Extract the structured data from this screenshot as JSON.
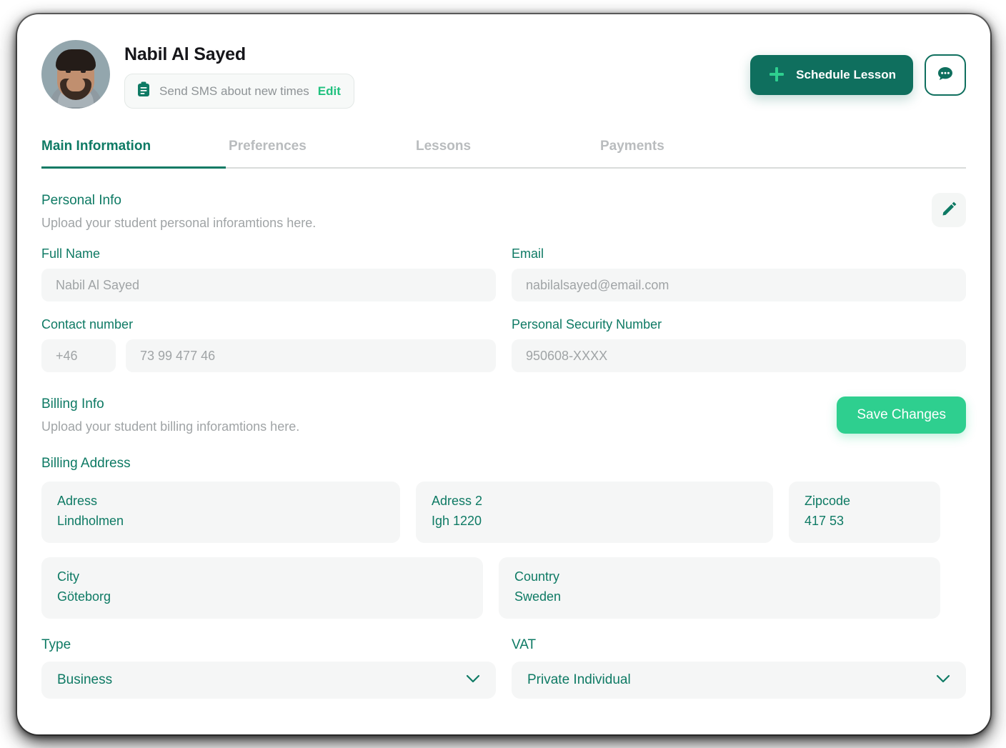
{
  "colors": {
    "teal": "#0e7a64",
    "dark_teal": "#0f6f5e",
    "green": "#2ecf8f",
    "gray_text": "#a0a4a6",
    "field_bg": "#f5f6f6"
  },
  "header": {
    "avatar_alt": "student-avatar",
    "name": "Nabil Al Sayed",
    "sms_badge": {
      "icon": "clipboard-icon",
      "text": "Send SMS about new times",
      "edit_label": "Edit"
    },
    "schedule_button": {
      "icon": "plus-icon",
      "label": "Schedule Lesson"
    },
    "chat_button": {
      "icon": "chat-bubble-dots-icon"
    }
  },
  "tabs": [
    {
      "label": "Main Information",
      "active": true
    },
    {
      "label": "Preferences",
      "active": false
    },
    {
      "label": "Lessons",
      "active": false
    },
    {
      "label": "Payments",
      "active": false
    }
  ],
  "personal_info": {
    "title": "Personal Info",
    "subtitle": "Upload your student personal inforamtions here.",
    "edit_icon": "pencil-icon",
    "fields": {
      "full_name": {
        "label": "Full Name",
        "placeholder": "Nabil Al Sayed",
        "value": ""
      },
      "email": {
        "label": "Email",
        "placeholder": "nabilalsayed@email.com",
        "value": ""
      },
      "contact_number": {
        "label": "Contact number",
        "country_code": "+46",
        "placeholder": "73 99 477 46",
        "value": ""
      },
      "security_number": {
        "label": "Personal Security Number",
        "placeholder": "950608-XXXX",
        "value": ""
      }
    }
  },
  "billing_info": {
    "title": "Billing Info",
    "subtitle": "Upload your student billing inforamtions here.",
    "save_label": "Save Changes",
    "address_heading": "Billing Address",
    "address_fields": [
      {
        "label": "Adress",
        "value": "Lindholmen"
      },
      {
        "label": "Adress 2",
        "value": "Igh 1220"
      },
      {
        "label": "Zipcode",
        "value": "417 53"
      },
      {
        "label": "City",
        "value": "Göteborg"
      },
      {
        "label": "Country",
        "value": "Sweden"
      }
    ],
    "selects": [
      {
        "label": "Type",
        "value": "Business",
        "icon": "chevron-down-icon"
      },
      {
        "label": "VAT",
        "value": "Private Individual",
        "icon": "chevron-down-icon"
      }
    ]
  }
}
